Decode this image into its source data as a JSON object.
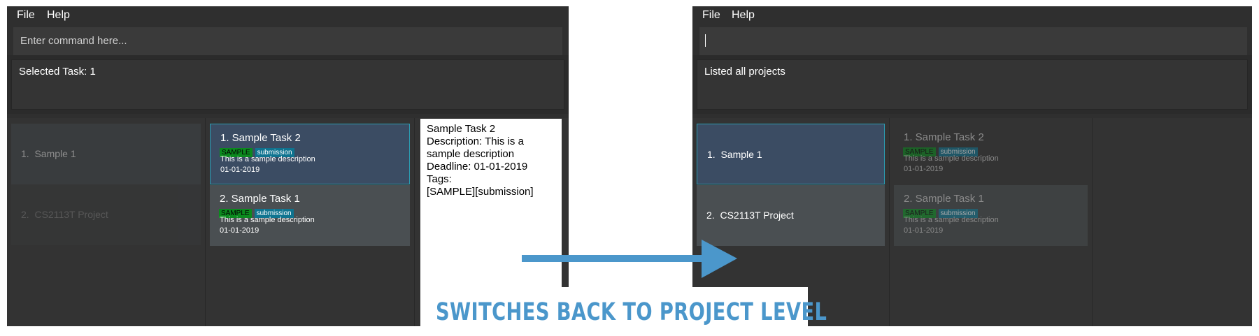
{
  "left_window": {
    "menu": [
      "File",
      "Help"
    ],
    "command_placeholder": "Enter command here...",
    "result_text": "Selected Task: 1",
    "projects": [
      {
        "index": "1.",
        "name": "Sample 1"
      },
      {
        "index": "2.",
        "name": "CS2113T Project"
      }
    ],
    "tasks": [
      {
        "title": "1.  Sample Task 2",
        "tags": [
          "SAMPLE",
          "submission"
        ],
        "description": "This is a sample description",
        "date": "01-01-2019"
      },
      {
        "title": "2.  Sample Task 1",
        "tags": [
          "SAMPLE",
          "submission"
        ],
        "description": "This is a sample description",
        "date": "01-01-2019"
      }
    ],
    "detail": {
      "lines": [
        "Sample Task 2",
        "Description: This is a",
        "sample description",
        "Deadline: 01-01-2019",
        "Tags:",
        "[SAMPLE][submission]"
      ]
    }
  },
  "right_window": {
    "menu": [
      "File",
      "Help"
    ],
    "command_value": "",
    "result_text": "Listed all projects",
    "projects": [
      {
        "index": "1.",
        "name": "Sample 1"
      },
      {
        "index": "2.",
        "name": "CS2113T Project"
      }
    ],
    "tasks": [
      {
        "title": "1.  Sample Task 2",
        "tags": [
          "SAMPLE",
          "submission"
        ],
        "description": "This is a sample description",
        "date": "01-01-2019"
      },
      {
        "title": "2.  Sample Task 1",
        "tags": [
          "SAMPLE",
          "submission"
        ],
        "description": "This is a sample description",
        "date": "01-01-2019"
      }
    ]
  },
  "caption": "SWITCHES BACK TO PROJECT LEVEL",
  "colors": {
    "arrow": "#4b97cb",
    "selected_card": "#3b4c63",
    "selected_border": "#2b9bb0",
    "tag_sample": "#0b8a1e",
    "tag_submission": "#0f7490"
  }
}
